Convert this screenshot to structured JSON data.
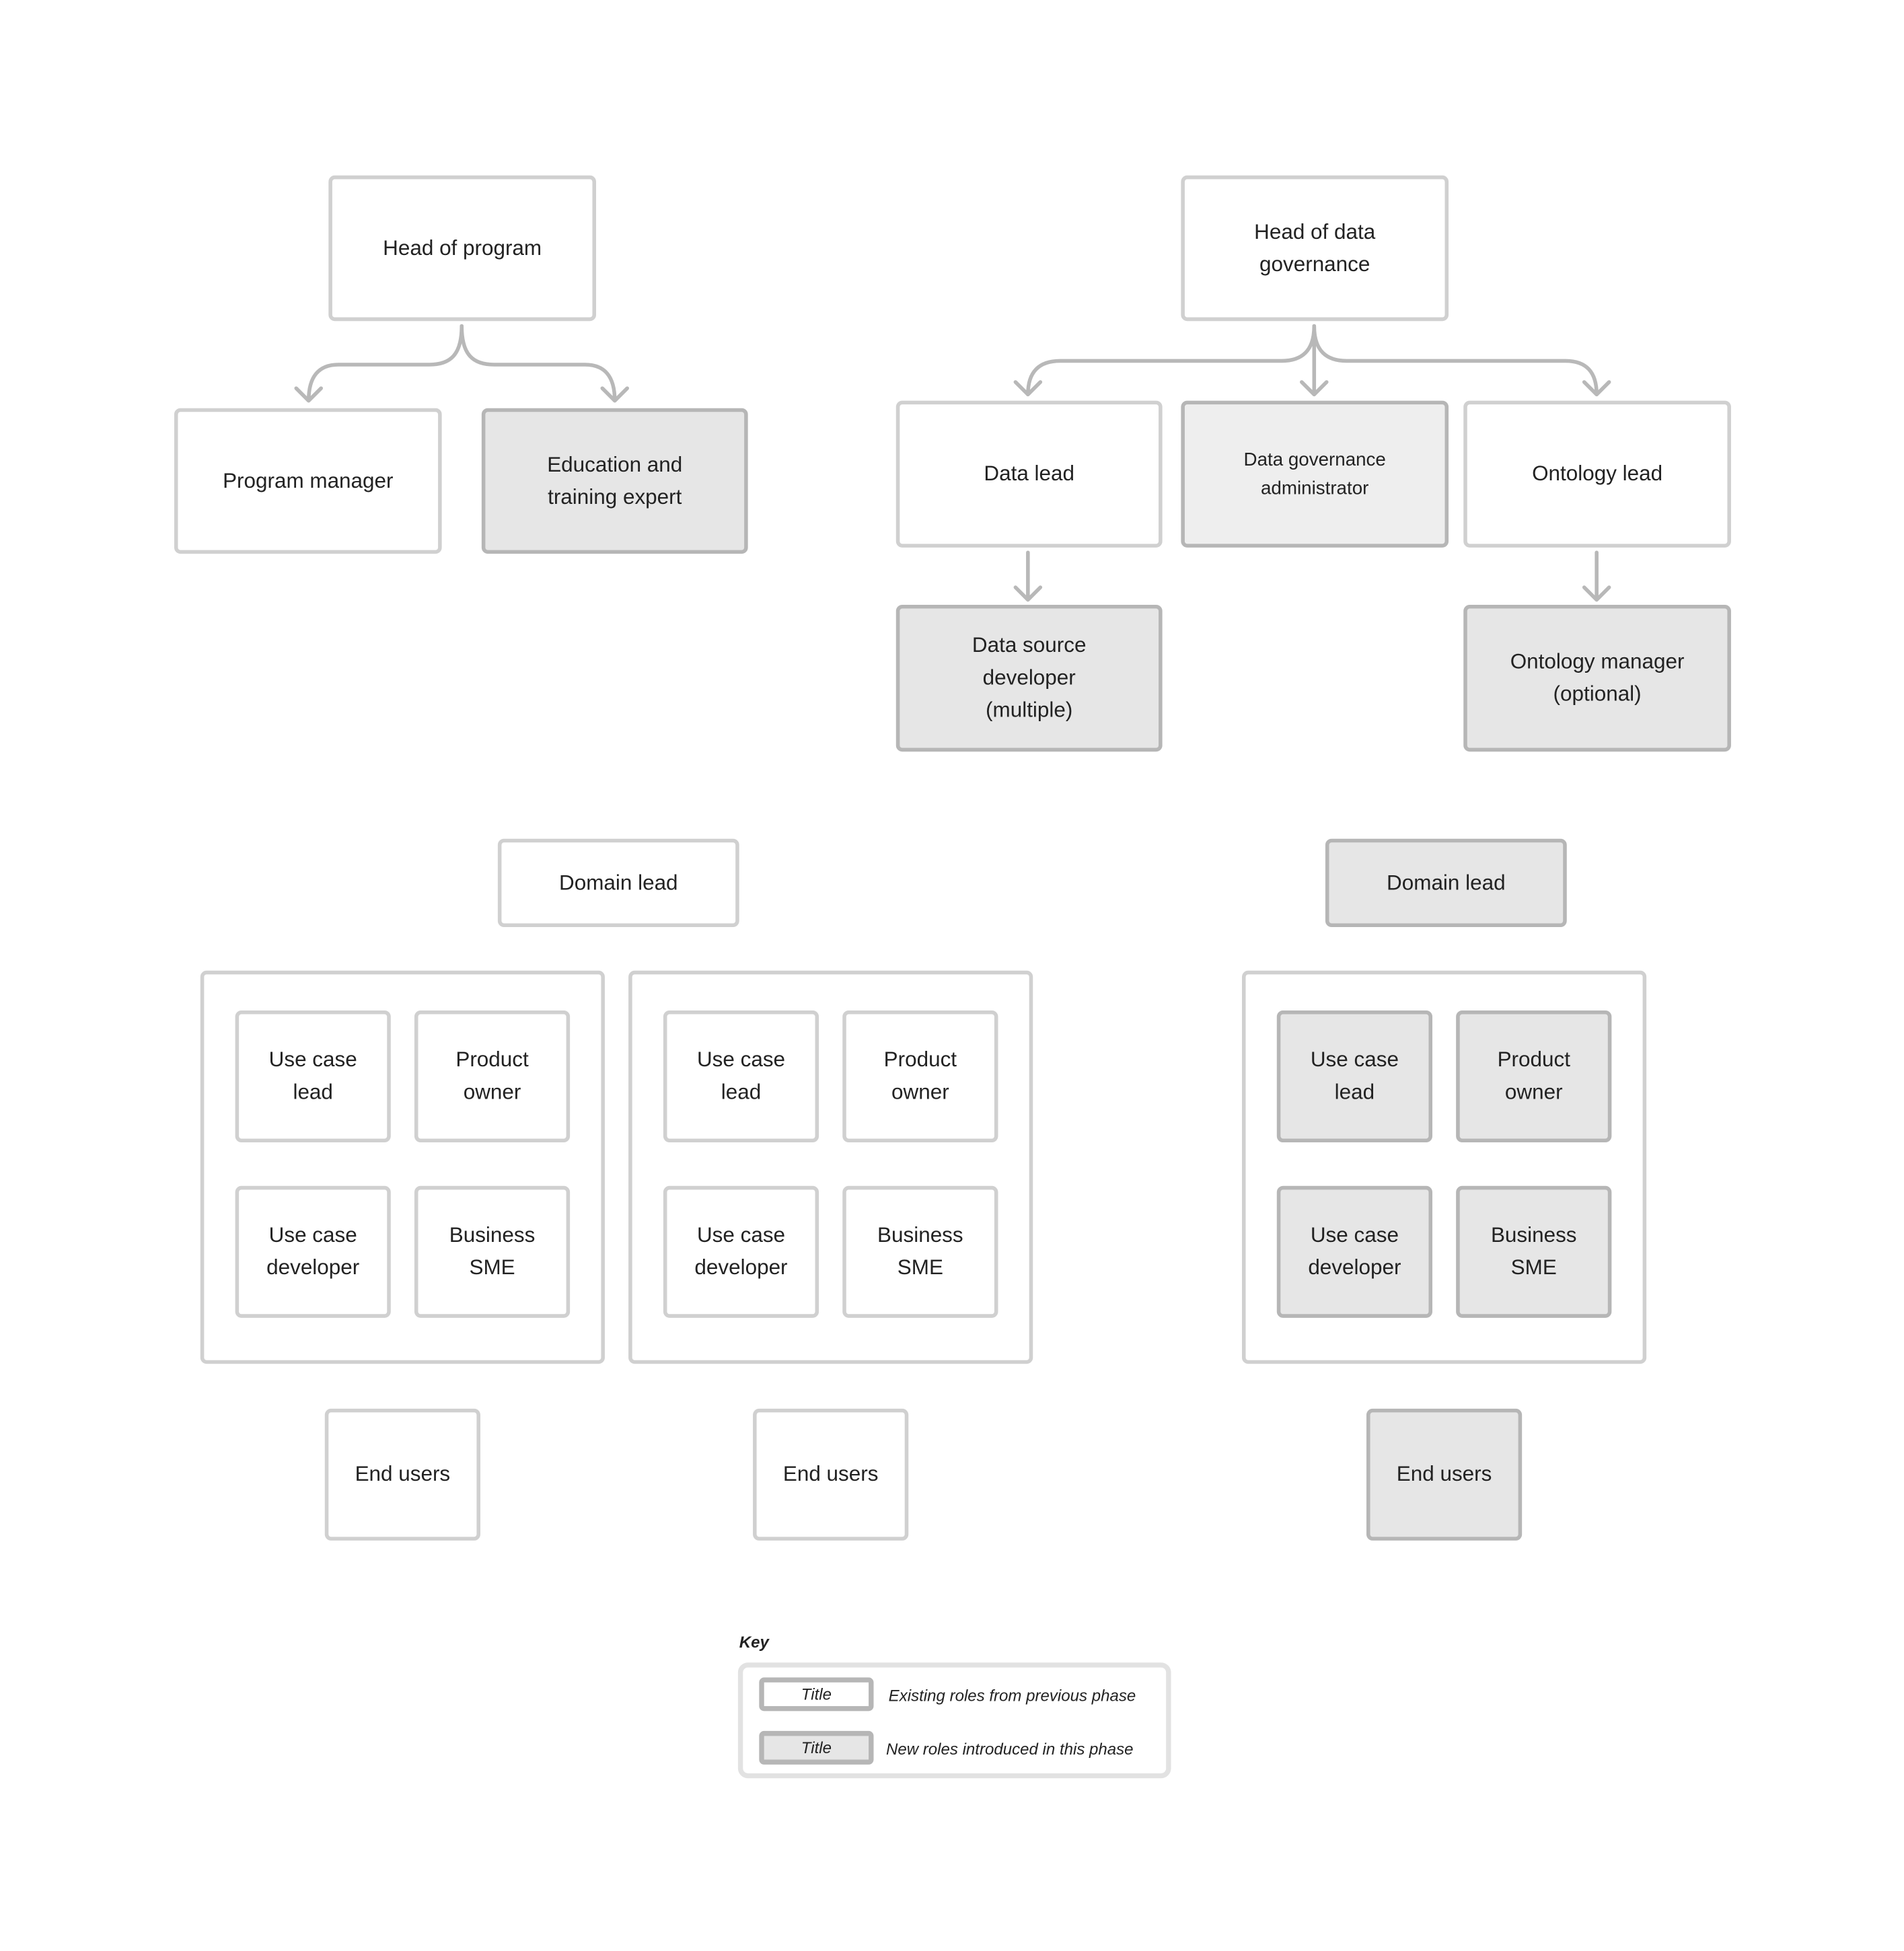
{
  "colors": {
    "existing_border": "#d0d0d0",
    "new_border": "#b6b6b6",
    "new_fill": "#e6e6e6",
    "connector": "#b8b8b8"
  },
  "program": {
    "head": "Head of program",
    "program_manager": "Program manager",
    "education": "Education and training expert"
  },
  "governance": {
    "head": "Head of data governance",
    "data_lead": "Data lead",
    "admin": "Data governance administrator",
    "ontology_lead": "Ontology lead",
    "data_source_dev": "Data source developer (multiple)",
    "ontology_manager": "Ontology manager (optional)"
  },
  "domains": [
    {
      "lead": "Domain lead",
      "roles": [
        "Use case lead",
        "Product owner",
        "Use case developer",
        "Business SME"
      ],
      "end_users": "End users"
    },
    {
      "roles": [
        "Use case lead",
        "Product owner",
        "Use case developer",
        "Business SME"
      ],
      "end_users": "End users"
    },
    {
      "lead": "Domain lead",
      "roles": [
        "Use case lead",
        "Product owner",
        "Use case developer",
        "Business SME"
      ],
      "end_users": "End users"
    }
  ],
  "key": {
    "label": "Key",
    "sample_title": "Title",
    "existing": "Existing roles from previous phase",
    "new": "New roles introduced in this phase"
  }
}
